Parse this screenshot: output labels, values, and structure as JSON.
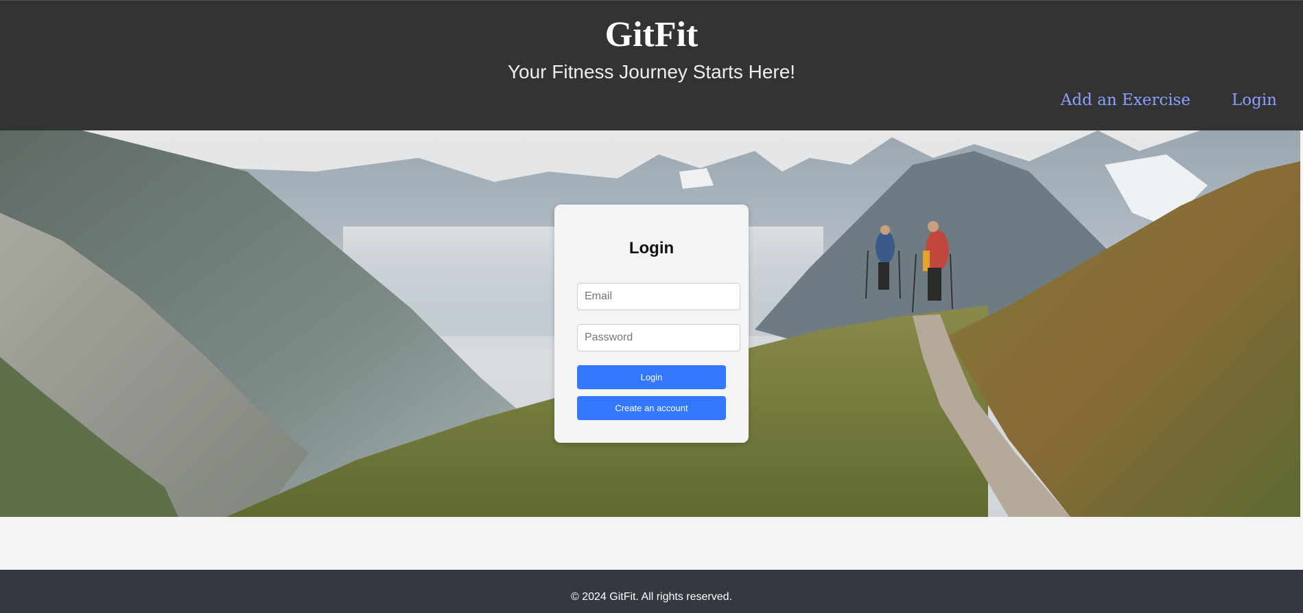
{
  "header": {
    "title": "GitFit",
    "tagline": "Your Fitness Journey Starts Here!",
    "nav": [
      {
        "label": "Add an Exercise"
      },
      {
        "label": "Login"
      }
    ]
  },
  "login": {
    "heading": "Login",
    "email_placeholder": "Email",
    "password_placeholder": "Password",
    "login_button": "Login",
    "create_account_button": "Create an account"
  },
  "footer": {
    "text": "© 2024 GitFit. All rights reserved."
  },
  "colors": {
    "header_bg": "#333333",
    "nav_link": "#8aa0ff",
    "button_bg": "#3478ff",
    "footer_bg": "#343841"
  }
}
